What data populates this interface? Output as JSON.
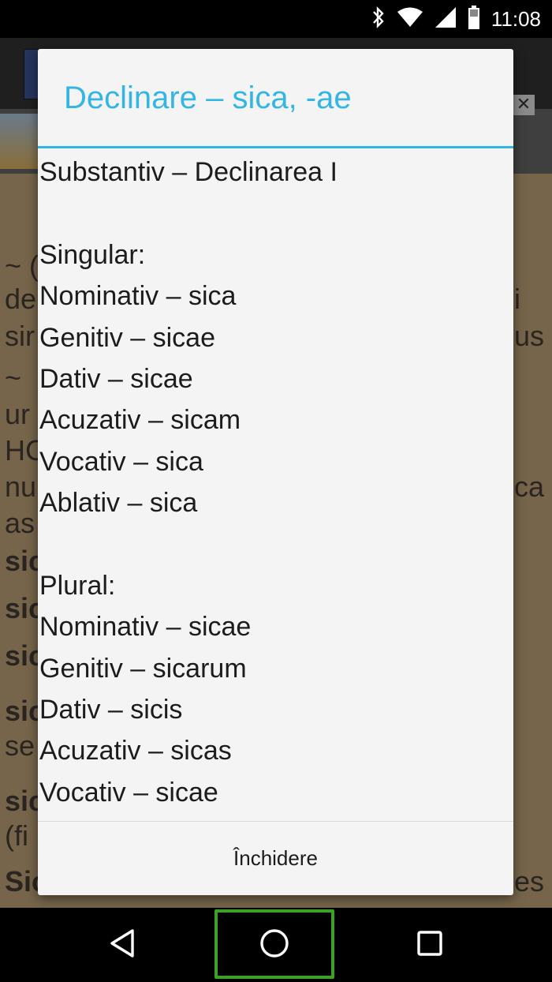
{
  "status_bar": {
    "time": "11:08",
    "icons": [
      "bluetooth-icon",
      "wifi-icon",
      "signal-icon",
      "battery-icon"
    ]
  },
  "dialog": {
    "title": "Declinare – sica, -ae",
    "lines": [
      "Substantiv – Declinarea I",
      "",
      "Singular:",
      "Nominativ – sica",
      "Genitiv – sicae",
      "Dativ – sicae",
      "Acuzativ – sicam",
      "Vocativ – sica",
      "Ablativ – sica",
      "",
      "Plural:",
      "Nominativ – sicae",
      "Genitiv – sicarum",
      "Dativ – sicis",
      "Acuzativ – sicas",
      "Vocativ – sicae"
    ],
    "close_label": "Închidere"
  },
  "background_text": {
    "l1": "~ (",
    "l2": "de",
    "l3": "sir",
    "l4": "~",
    "l5": "ur",
    "l6": "HC",
    "l7": "nu",
    "l8": "as",
    "l9": "sic",
    "l10": "sic",
    "l11": "sic",
    "l12": "sic",
    "l13": "se",
    "l14": "sic",
    "l15": "(fi",
    "l16": "Sic",
    "r1": "i",
    "r2": "us",
    "r3": "ca",
    "r4": "es"
  },
  "ad": {
    "close_label": "✕"
  },
  "nav": {
    "back": "back-icon",
    "home": "home-icon",
    "recents": "recents-icon"
  },
  "colors": {
    "accent": "#33b5e5",
    "dialog_bg": "#f4f4f4",
    "highlight": "#3aa327"
  }
}
